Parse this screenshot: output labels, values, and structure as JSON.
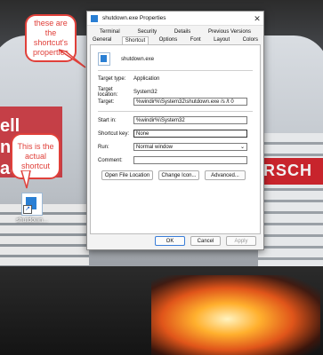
{
  "dialog": {
    "title": "shutdown.exe Properties",
    "close_glyph": "✕",
    "tabs_back": [
      "Terminal",
      "Security",
      "Details",
      "Previous Versions"
    ],
    "tabs_front": [
      "General",
      "Shortcut",
      "Options",
      "Font",
      "Layout",
      "Colors"
    ],
    "active_tab": "Shortcut",
    "shortcut_name": "shutdown.exe",
    "target_type": {
      "label": "Target type:",
      "value": "Application"
    },
    "target_location": {
      "label": "Target location:",
      "value": "System32"
    },
    "target": {
      "label": "Target:",
      "value": "%windir%\\System32\\shutdown.exe /s /t 0"
    },
    "start_in": {
      "label": "Start in:",
      "value": "%windir%\\System32"
    },
    "shortcut_key": {
      "label": "Shortcut key:",
      "value": "None"
    },
    "run": {
      "label": "Run:",
      "value": "Normal window"
    },
    "comment": {
      "label": "Comment:",
      "value": ""
    },
    "buttons": {
      "open_file_location": "Open File Location",
      "change_icon": "Change Icon...",
      "advanced": "Advanced...",
      "ok": "OK",
      "cancel": "Cancel",
      "apply": "Apply"
    }
  },
  "callouts": {
    "top": "these are the shortcut's properties",
    "bottom": "This is the actual shortcut"
  },
  "desktop_icon": {
    "label": "shutdown..."
  },
  "background": {
    "left_text": "ell\nn\nader",
    "right_text": "RSCH"
  },
  "colors": {
    "callout_red": "#e0403a",
    "accent_blue": "#2a7fd4"
  }
}
